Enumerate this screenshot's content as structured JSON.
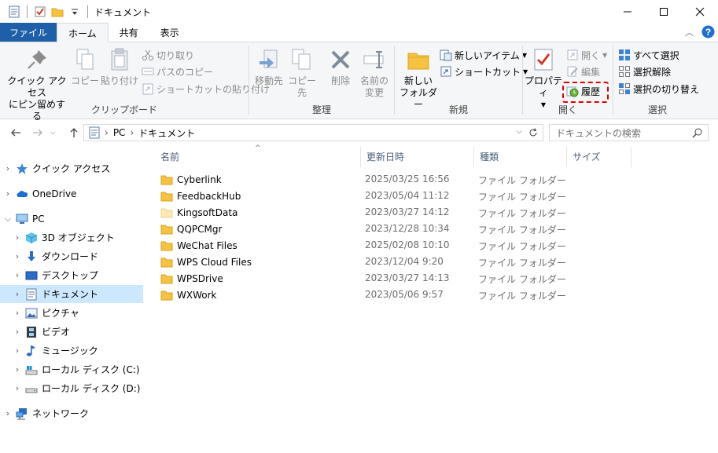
{
  "window": {
    "title": "ドキュメント",
    "controls": [
      "minimize-icon",
      "maximize-icon",
      "close-icon"
    ]
  },
  "ribbon_tabs": [
    {
      "label": "ファイル"
    },
    {
      "label": "ホーム"
    },
    {
      "label": "共有"
    },
    {
      "label": "表示"
    }
  ],
  "ribbon": {
    "clipboard": {
      "label": "クリップボード",
      "pin_line1": "クイック アクセス",
      "pin_line2": "にピン留めする",
      "copy": "コピー",
      "paste": "貼り付け",
      "cut": "切り取り",
      "copy_path": "パスのコピー",
      "paste_shortcut": "ショートカットの貼り付け"
    },
    "organize": {
      "label": "整理",
      "move_to": "移動先",
      "copy_to": "コピー先",
      "delete": "削除",
      "rename_line1": "名前の",
      "rename_line2": "変更"
    },
    "new": {
      "label": "新規",
      "new_folder_line1": "新しい",
      "new_folder_line2": "フォルダー",
      "new_item": "新しいアイテム",
      "shortcut": "ショートカット"
    },
    "open": {
      "label": "開く",
      "properties": "プロパティ",
      "open": "開く",
      "edit": "編集",
      "history": "履歴"
    },
    "select": {
      "label": "選択",
      "select_all": "すべて選択",
      "select_none": "選択解除",
      "invert": "選択の切り替え"
    }
  },
  "address": {
    "crumbs": [
      "PC",
      "ドキュメント"
    ],
    "search_placeholder": "ドキュメントの検索"
  },
  "nav": {
    "quick_access": "クイック アクセス",
    "onedrive": "OneDrive",
    "pc": "PC",
    "objects3d": "3D オブジェクト",
    "downloads": "ダウンロード",
    "desktop": "デスクトップ",
    "documents": "ドキュメント",
    "pictures": "ピクチャ",
    "videos": "ビデオ",
    "music": "ミュージック",
    "disk_c": "ローカル ディスク (C:)",
    "disk_d": "ローカル ディスク (D:)",
    "network": "ネットワーク"
  },
  "columns": {
    "name": "名前",
    "modified": "更新日時",
    "type": "種類",
    "size": "サイズ"
  },
  "files": [
    {
      "name": "Cyberlink",
      "date": "2025/03/25 16:56",
      "type": "ファイル フォルダー"
    },
    {
      "name": "FeedbackHub",
      "date": "2023/05/04 11:12",
      "type": "ファイル フォルダー"
    },
    {
      "name": "KingsoftData",
      "date": "2023/03/27 14:12",
      "type": "ファイル フォルダー"
    },
    {
      "name": "QQPCMgr",
      "date": "2023/12/28 10:34",
      "type": "ファイル フォルダー"
    },
    {
      "name": "WeChat Files",
      "date": "2025/02/08 10:10",
      "type": "ファイル フォルダー"
    },
    {
      "name": "WPS Cloud Files",
      "date": "2023/12/04 9:20",
      "type": "ファイル フォルダー"
    },
    {
      "name": "WPSDrive",
      "date": "2023/03/27 14:13",
      "type": "ファイル フォルダー"
    },
    {
      "name": "WXWork",
      "date": "2023/05/06 9:57",
      "type": "ファイル フォルダー"
    }
  ],
  "colors": {
    "file_tab": "#1f5faa",
    "selection": "#cce8ff",
    "highlight_box": "#e00000",
    "folder": "#f5c242"
  }
}
